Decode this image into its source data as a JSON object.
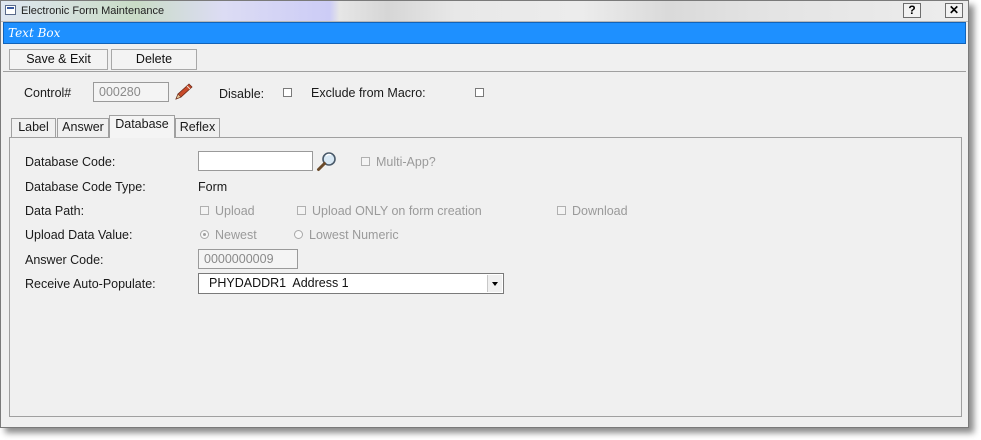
{
  "window": {
    "title": "Electronic Form Maintenance",
    "help_label": "?",
    "close_label": "✕"
  },
  "banner": {
    "text": "Text Box"
  },
  "toolbar": {
    "save_exit_label": "Save & Exit",
    "delete_label": "Delete"
  },
  "header": {
    "control_label": "Control#",
    "control_value": "000280",
    "disable_label": "Disable:",
    "disable_checked": false,
    "exclude_label": "Exclude from Macro:",
    "exclude_checked": false
  },
  "tabs": [
    {
      "label": "Label",
      "active": false
    },
    {
      "label": "Answer",
      "active": false
    },
    {
      "label": "Database",
      "active": true
    },
    {
      "label": "Reflex",
      "active": false
    }
  ],
  "database": {
    "database_code_label": "Database Code:",
    "database_code_value": "",
    "multi_app_label": "Multi-App?",
    "code_type_label": "Database Code Type:",
    "code_type_value": "Form",
    "data_path_label": "Data Path:",
    "upload_label": "Upload",
    "upload_only_label": "Upload ONLY on form creation",
    "download_label": "Download",
    "upload_value_label": "Upload Data Value:",
    "newest_label": "Newest",
    "lowest_label": "Lowest Numeric",
    "answer_code_label": "Answer Code:",
    "answer_code_value": "0000000009",
    "receive_label": "Receive Auto-Populate:",
    "receive_value": "PHYDADDR1  Address 1"
  },
  "colors": {
    "banner": "#1e90ff",
    "banner_text": "#ffffff",
    "window_bg": "#f0f0f0"
  },
  "icons": {
    "edit": "pencil-icon",
    "lookup": "magnifier-icon",
    "app": "form-app-icon"
  }
}
